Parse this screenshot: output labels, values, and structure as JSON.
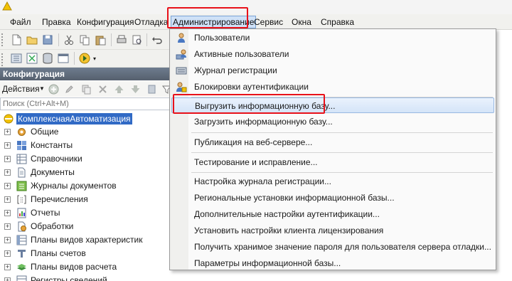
{
  "menubar": {
    "items": [
      "Файл",
      "Правка",
      "Конфигурация",
      "Отладка",
      "Администрирование",
      "Сервис",
      "Окна",
      "Справка"
    ]
  },
  "panel": {
    "title": "Конфигурация",
    "actions_label": "Действия",
    "search_placeholder": "Поиск (Ctrl+Alt+M)"
  },
  "tree": {
    "root": "КомплекснаяАвтоматизация",
    "items": [
      {
        "label": "Общие",
        "icon": "general-icon"
      },
      {
        "label": "Константы",
        "icon": "constants-icon"
      },
      {
        "label": "Справочники",
        "icon": "catalogs-icon"
      },
      {
        "label": "Документы",
        "icon": "documents-icon"
      },
      {
        "label": "Журналы документов",
        "icon": "journals-icon"
      },
      {
        "label": "Перечисления",
        "icon": "enums-icon"
      },
      {
        "label": "Отчеты",
        "icon": "reports-icon"
      },
      {
        "label": "Обработки",
        "icon": "processing-icon"
      },
      {
        "label": "Планы видов характеристик",
        "icon": "characteristic-types-icon"
      },
      {
        "label": "Планы счетов",
        "icon": "chart-of-accounts-icon"
      },
      {
        "label": "Планы видов расчета",
        "icon": "calculation-types-icon"
      },
      {
        "label": "Регистры сведений",
        "icon": "info-registers-icon"
      }
    ]
  },
  "dropdown": {
    "items": [
      {
        "label": "Пользователи",
        "icon": "users-icon"
      },
      {
        "label": "Активные пользователи",
        "icon": "active-users-icon"
      },
      {
        "label": "Журнал регистрации",
        "icon": "event-log-icon"
      },
      {
        "label": "Блокировки аутентификации",
        "icon": "auth-lock-icon"
      },
      {
        "label": "Выгрузить информационную базу...",
        "icon": ""
      },
      {
        "label": "Загрузить информационную базу...",
        "icon": ""
      },
      {
        "label": "Публикация на веб-сервере...",
        "icon": ""
      },
      {
        "label": "Тестирование и исправление...",
        "icon": ""
      },
      {
        "label": "Настройка журнала регистрации...",
        "icon": ""
      },
      {
        "label": "Региональные установки информационной базы...",
        "icon": ""
      },
      {
        "label": "Дополнительные настройки аутентификации...",
        "icon": ""
      },
      {
        "label": "Установить настройки клиента лицензирования",
        "icon": ""
      },
      {
        "label": "Получить хранимое значение пароля для пользователя сервера отладки...",
        "icon": ""
      },
      {
        "label": "Параметры информационной базы...",
        "icon": ""
      }
    ],
    "highlighted_index": 4
  },
  "colors": {
    "highlight_border": "#e8111a",
    "selection": "#316ac5",
    "panel_header": "#5e6a7a"
  }
}
